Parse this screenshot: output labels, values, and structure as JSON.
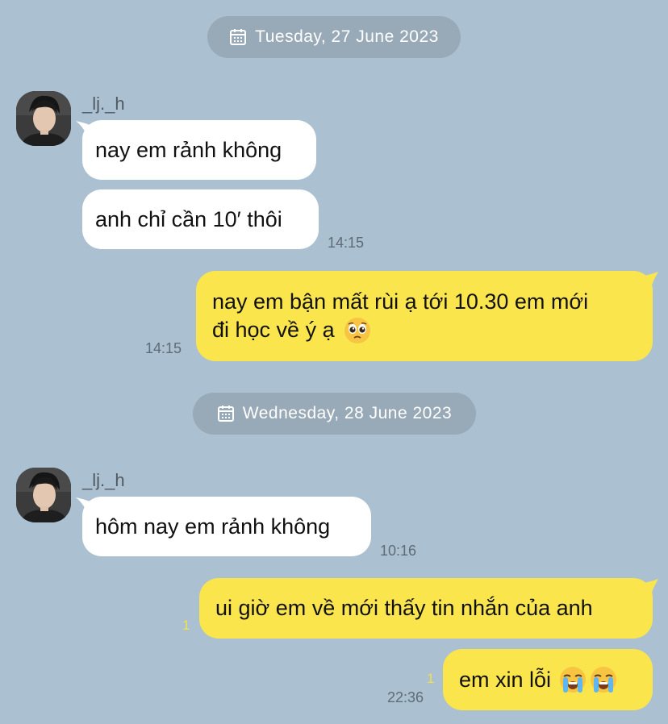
{
  "days": [
    {
      "date": "Tuesday, 27 June 2023"
    },
    {
      "date": "Wednesday, 28 June 2023"
    }
  ],
  "contact": {
    "name": "_lj._h"
  },
  "messages": {
    "m1": "nay em rảnh không",
    "m2": "anh chỉ cần 10′ thôi",
    "m2_time": "14:15",
    "m3_line1": "nay em bận mất rùi ạ tới 10.30 em mới",
    "m3_line2": "đi học về ý ạ",
    "m3_emoji": "pleading-face-emoji",
    "m3_time": "14:15",
    "m4": "hôm nay em rảnh không",
    "m4_time": "10:16",
    "m5": "ui giờ em về mới thấy tin nhắn của anh",
    "m5_unread": "1",
    "m6": "em xin lỗi",
    "m6_emoji": "loudly-crying-face-emoji",
    "m6_unread": "1",
    "m6_time": "22:36"
  },
  "colors": {
    "background": "#abc1d1",
    "incoming_bubble": "#ffffff",
    "outgoing_bubble": "#fbe54d",
    "date_pill": "#98a9b8",
    "unread_count": "#f2e04a"
  }
}
